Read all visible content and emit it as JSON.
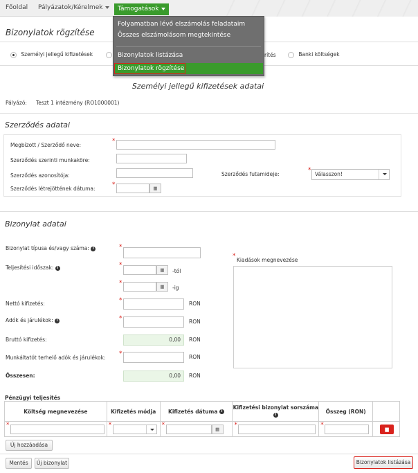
{
  "nav": {
    "home": "Főoldal",
    "applications": "Pályázatok/Kérelmek",
    "support": "Támogatások"
  },
  "menu": {
    "items": [
      "Folyamatban lévő elszámolás feladataim",
      "Összes elszámolásom megtekintése",
      "Bizonylatok listázása",
      "Bizonylatok rögzítése"
    ]
  },
  "page": {
    "title": "Bizonylatok rögzítése",
    "radio_personal": "Személyi jellegű kifizetések",
    "radio_partial": "rítés",
    "radio_bank": "Banki költségek",
    "subtitle": "Személyi jellegű kifizetések adatai",
    "applicant_label": "Pályázó:",
    "applicant_value": "Teszt 1 intézmény (RO1000001)"
  },
  "contract": {
    "heading": "Szerződés adatai",
    "name_label": "Megbízott / Szerződő neve:",
    "role_label": "Szerződés szerinti munkaköre:",
    "id_label": "Szerződés azonosítója:",
    "term_label": "Szerződés futamideje:",
    "term_value": "Válasszon!",
    "date_label": "Szerződés létrejöttének dátuma:"
  },
  "doc": {
    "heading": "Bizonylat adatai",
    "type_label": "Bizonylat típusa és/vagy száma:",
    "period_label": "Teljesítési időszak:",
    "from_suffix": "-tól",
    "to_suffix": "-ig",
    "net_label": "Nettó kifizetés:",
    "tax_label": "Adók és járulékok:",
    "gross_label": "Bruttó kifizetés:",
    "gross_value": "0,00",
    "employer_label": "Munkáltatót terhelő adók és járulékok:",
    "total_label": "Összesen:",
    "total_value": "0,00",
    "currency": "RON",
    "expense_label": "Kiadások megnevezése"
  },
  "finance": {
    "heading": "Pénzügyi teljesítés",
    "columns": [
      "Költség megnevezése",
      "Kifizetés módja",
      "Kifizetés dátuma",
      "Kifizetési bizonylat sorszáma",
      "Összeg (RON)"
    ],
    "add_button": "Új hozzáadása"
  },
  "footer": {
    "save": "Mentés",
    "new_doc": "Új bizonylat",
    "list_docs": "Bizonylatok listázása"
  },
  "icons": {
    "info": "i",
    "calendar": "calendar-icon",
    "trash": "trash-icon"
  },
  "colors": {
    "accent": "#3a9b2c",
    "danger": "#d9231d",
    "menu_bg": "#6f6f6f"
  }
}
